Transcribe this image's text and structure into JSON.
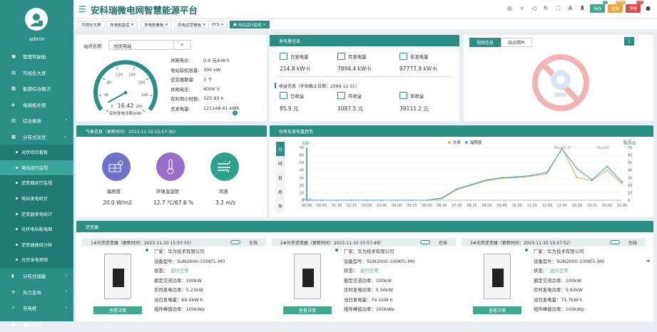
{
  "user": {
    "name": "admin"
  },
  "sidebar": {
    "items": [
      {
        "label": "管理驾驶舱"
      },
      {
        "label": "可视化大屏"
      },
      {
        "label": "能源综合概况"
      },
      {
        "label": "电网拓扑图"
      },
      {
        "label": "综合报表"
      },
      {
        "label": "分布式光伏"
      }
    ],
    "subs": [
      {
        "label": "光伏综合看板"
      },
      {
        "label": "电站运行监视"
      },
      {
        "label": "逆变器运行监视"
      },
      {
        "label": "电站发电统计"
      },
      {
        "label": "逆变器发电统计"
      },
      {
        "label": "光伏电站配电图"
      },
      {
        "label": "逆变器曲线分析"
      },
      {
        "label": "光伏发电预测"
      }
    ],
    "bottom": [
      {
        "label": "分布式储能"
      },
      {
        "label": "风力发电"
      },
      {
        "label": "充电桩"
      },
      {
        "label": "电力监控"
      }
    ]
  },
  "header": {
    "title": "安科瑞微电网智慧能源平台"
  },
  "toolbar": {
    "btn1": "待办",
    "badge1": "2",
    "btn2": "告警",
    "badge2": "99+",
    "btn3": "预警",
    "badge3": "14"
  },
  "tabs": [
    "可视化大屏",
    "充电桩监控",
    "充电桩看板",
    "风电运营看板",
    "PCS",
    "电站运行监视"
  ],
  "station": {
    "selector_label": "站点名称",
    "selector_value": "光伏电站",
    "gauge_value": "16.42",
    "gauge_label": "实时发电功率(kW)",
    "gauge_ticks": [
      "0",
      "40",
      "80",
      "120",
      "160",
      "200",
      "240",
      "280"
    ],
    "gauge_fraction": 0.059,
    "info": [
      {
        "k": "并网电价:",
        "v": "0.4 元/kW·h"
      },
      {
        "k": "电站装机容量:",
        "v": "300 kW"
      },
      {
        "k": "逆变器数量:",
        "v": "3 个"
      },
      {
        "k": "并网电压:",
        "v": "400V V"
      },
      {
        "k": "有利用小时数:",
        "v": "325.93 h"
      },
      {
        "k": "总发电量:",
        "v": "121148.41 kWh"
      }
    ]
  },
  "gen": {
    "title": "发电量信息",
    "day_label": "日发电量",
    "day_value": "214.8 kW·h",
    "month_label": "月发电量",
    "month_value": "7894.4 kW·h",
    "year_label": "年发电量",
    "year_value": "97777.9 kW·h",
    "income_title": "收益信息（补贴截止日期：2099-12-31）",
    "income_day_label": "日收益",
    "income_day": "85.9 元",
    "income_month_label": "月收益",
    "income_month": "1087.5 元",
    "income_year_label": "年收益",
    "income_year": "39111.2 元"
  },
  "video": {
    "tab1": "视频信息",
    "tab2": "站点照片",
    "count": "1"
  },
  "weather": {
    "title": "气象信息（更新时间：2023-11-10 15:57:30）",
    "irr_label": "辐照度",
    "irr_value": "20.0 W/m2",
    "temp_label": "环境温湿度",
    "temp_value": "12.7 ℃/67.6 %",
    "wind_label": "风速",
    "wind_value": "3.2 m/s"
  },
  "power": {
    "title": "功率及发电量趋势",
    "tabs": [
      "分",
      "时",
      "日",
      "月",
      "年"
    ],
    "legend1": "功率",
    "legend2": "辐照度",
    "unit_left": "kW",
    "unit_right": "W/m2",
    "max_label": "Max68.97",
    "max2_label": "Max68",
    "min_label": "Min0"
  },
  "chart_data": {
    "type": "line",
    "x": [
      "00:00",
      "00:45",
      "01:30",
      "02:15",
      "03:00",
      "03:45",
      "04:30",
      "05:15",
      "06:00",
      "06:45",
      "07:30",
      "08:15",
      "09:00",
      "09:45",
      "10:30",
      "11:15",
      "12:00",
      "12:45",
      "13:30",
      "14:15",
      "15:00",
      "15:45"
    ],
    "series": [
      {
        "name": "功率",
        "values": [
          0,
          0,
          0,
          0,
          0,
          0,
          0,
          0,
          0,
          2,
          14,
          20,
          26,
          29,
          30,
          32,
          35,
          69,
          30,
          26,
          40,
          22
        ]
      },
      {
        "name": "辐照度",
        "values": [
          0,
          0,
          0,
          0,
          0,
          0,
          0,
          0,
          0,
          3,
          15,
          21,
          27,
          30,
          31,
          33,
          37,
          68,
          42,
          27,
          45,
          24
        ]
      }
    ],
    "ylim": [
      0,
      70
    ],
    "y_ticks": [
      "0",
      "10",
      "20",
      "30",
      "40",
      "50",
      "60",
      "70"
    ],
    "y2lim": [
      0,
      70
    ],
    "y2_ticks": [
      "0",
      "10",
      "20",
      "30",
      "40",
      "50",
      "60",
      "70"
    ],
    "xlabel": "",
    "ylabel": "kW",
    "y2label": "W/m2",
    "series_colors": [
      "#f7a93b",
      "#3ea7d8"
    ]
  },
  "inverter": {
    "title": "逆变器",
    "items": [
      {
        "head": "1#光伏逆变器（更新时间：2023-11-10 15:57:55）",
        "status": "在线",
        "maker": "厂家：华为技术有限公司",
        "model": "设备型号：SUN2000-100KTL-M0",
        "state_k": "状态：",
        "state_v": "运行正常",
        "rated": "额定交流功率：100kW",
        "realtime": "实时发电功率：5.23kW",
        "today": "当日发电量：69.0kW·h",
        "group": "组件峰值功率：100kWp",
        "btn": "查看详情"
      },
      {
        "head": "2#光伏逆变器（更新时间：2023-11-10 15:57:49）",
        "status": "在线",
        "maker": "厂家：华为技术有限公司",
        "model": "设备型号：SUN2000-100KTL-M0",
        "state_k": "状态：",
        "state_v": "运行正常",
        "rated": "额定交流功率：100kW",
        "realtime": "实时发电功率：5.56kW",
        "today": "当日发电量：74.1kW·h",
        "group": "组件峰值功率：100kWp",
        "btn": "查看详情"
      },
      {
        "head": "3#光伏逆变器（更新时间：2023-11-10 15:57:52）",
        "status": "在线",
        "maker": "厂家：华为技术有限公司",
        "model": "设备型号：SUN2000-100KTL-M0",
        "state_k": "状态：",
        "state_v": "运行正常",
        "rated": "额定交流功率：100kW",
        "realtime": "实时发电功率：5.63kW",
        "today": "当日发电量：71.7kW·h",
        "group": "组件峰值功率：100kWp",
        "btn": "查看详情"
      }
    ]
  }
}
